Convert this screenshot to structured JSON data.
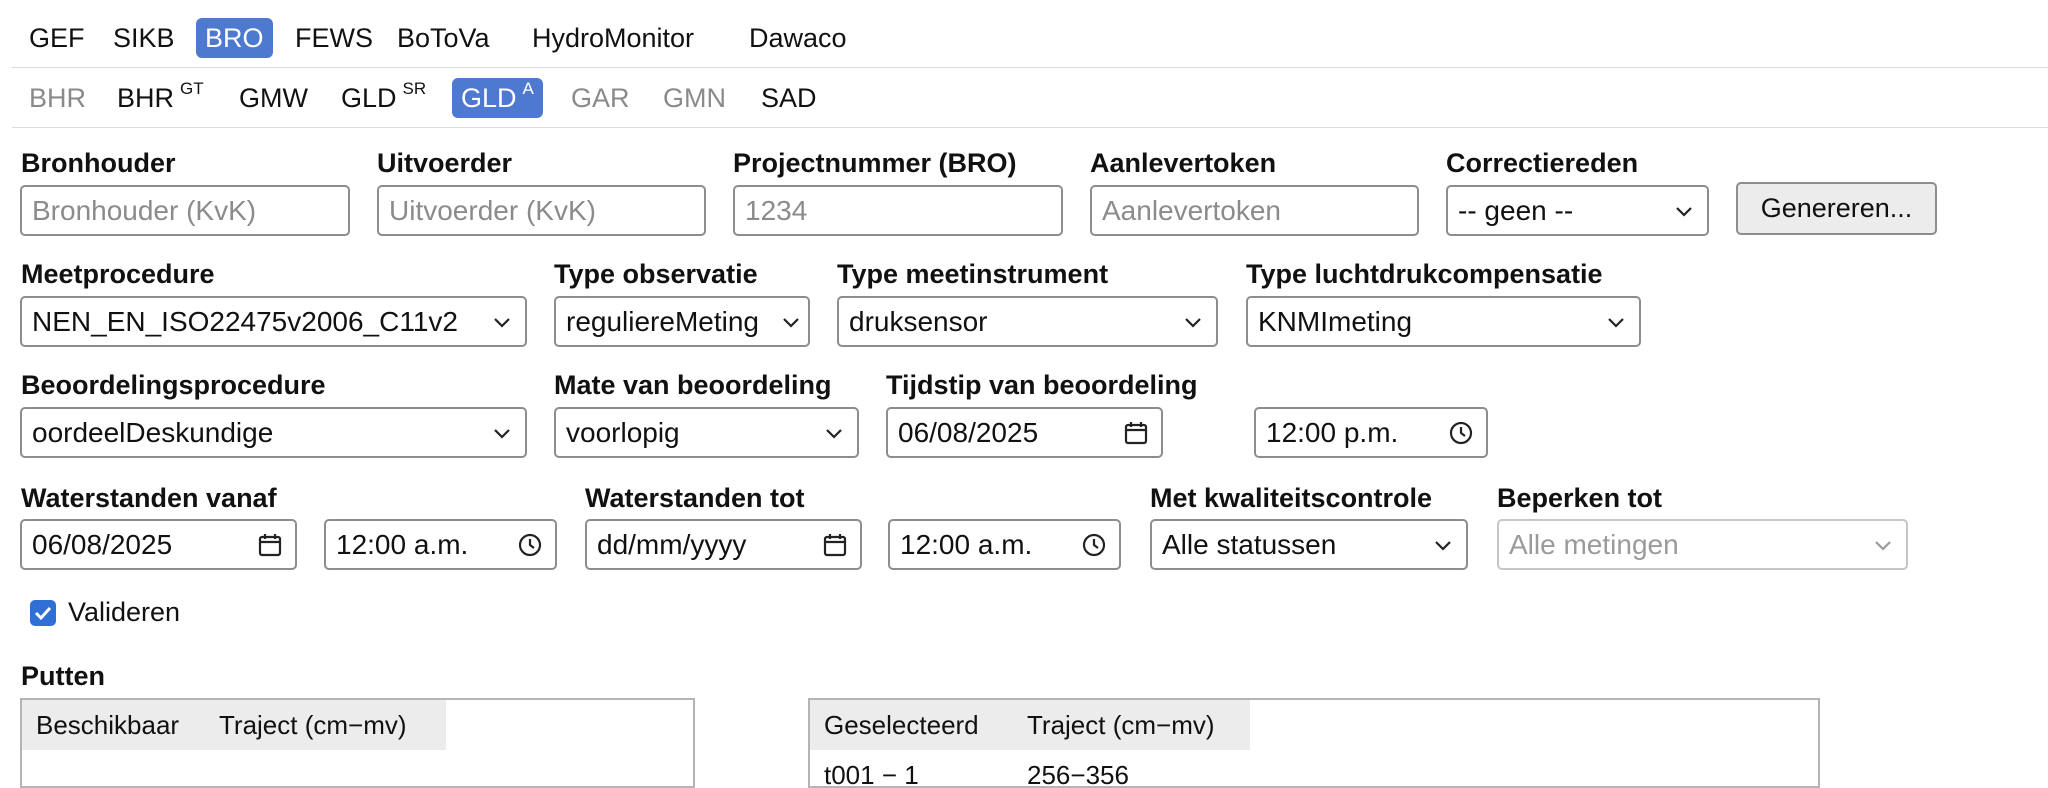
{
  "top_tabs": [
    {
      "label": "GEF"
    },
    {
      "label": "SIKB"
    },
    {
      "label": "BRO"
    },
    {
      "label": "FEWS"
    },
    {
      "label": "BoToVa"
    },
    {
      "label": "HydroMonitor"
    },
    {
      "label": "Dawaco"
    }
  ],
  "active_top_tab": "BRO",
  "sub_tabs": [
    {
      "label": "BHR",
      "sup": ""
    },
    {
      "label": "BHR",
      "sup": "GT"
    },
    {
      "label": "GMW",
      "sup": ""
    },
    {
      "label": "GLD",
      "sup": "SR"
    },
    {
      "label": "GLD",
      "sup": "A"
    },
    {
      "label": "GAR",
      "sup": ""
    },
    {
      "label": "GMN",
      "sup": ""
    },
    {
      "label": "SAD",
      "sup": ""
    }
  ],
  "form": {
    "bronhouder": {
      "label": "Bronhouder",
      "placeholder": "Bronhouder (KvK)"
    },
    "uitvoerder": {
      "label": "Uitvoerder",
      "placeholder": "Uitvoerder (KvK)"
    },
    "projectnummer": {
      "label": "Projectnummer (BRO)",
      "placeholder": "1234"
    },
    "aanlevertoken": {
      "label": "Aanlevertoken",
      "placeholder": "Aanlevertoken"
    },
    "correctiereden": {
      "label": "Correctiereden",
      "value": "-- geen --"
    },
    "genereren_button": "Genereren...",
    "meetprocedure": {
      "label": "Meetprocedure",
      "value": "NEN_EN_ISO22475v2006_C11v2"
    },
    "type_observatie": {
      "label": "Type observatie",
      "value": "reguliereMeting"
    },
    "type_meetinstrument": {
      "label": "Type meetinstrument",
      "value": "druksensor"
    },
    "type_luchtdruk": {
      "label": "Type luchtdrukcompensatie",
      "value": "KNMImeting"
    },
    "beoordelingsprocedure": {
      "label": "Beoordelingsprocedure",
      "value": "oordeelDeskundige"
    },
    "mate_beoordeling": {
      "label": "Mate van beoordeling",
      "value": "voorlopig"
    },
    "tijdstip_beoordeling": {
      "label": "Tijdstip van beoordeling",
      "date": "06/08/2025",
      "time": "12:00 p.m."
    },
    "waterstanden_vanaf": {
      "label": "Waterstanden vanaf",
      "date": "06/08/2025",
      "time": "12:00 a.m."
    },
    "waterstanden_tot": {
      "label": "Waterstanden tot",
      "date": "dd/mm/yyyy",
      "time": "12:00 a.m."
    },
    "kwaliteitscontrole": {
      "label": "Met kwaliteitscontrole",
      "value": "Alle statussen"
    },
    "beperken_tot": {
      "label": "Beperken tot",
      "value": "Alle metingen"
    },
    "valideren": {
      "label": "Valideren",
      "checked": true
    }
  },
  "putten": {
    "label": "Putten",
    "available": {
      "columns": [
        "Beschikbaar",
        "Traject (cm−mv)"
      ],
      "rows": []
    },
    "selected": {
      "columns": [
        "Geselecteerd",
        "Traject (cm−mv)"
      ],
      "rows": [
        [
          "t001 − 1",
          "256−356"
        ]
      ]
    }
  },
  "colors": {
    "accent": "#4d79d1",
    "checkbox": "#2f6fd6",
    "disabled_text": "#8a8a8a"
  }
}
